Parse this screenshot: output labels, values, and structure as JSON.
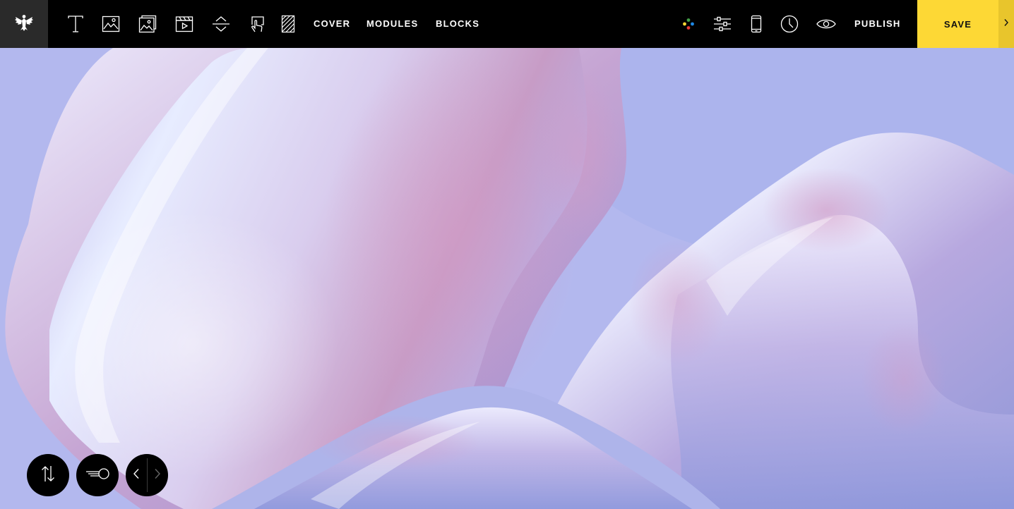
{
  "toolbar": {
    "logo_icon": "eagle-logo-icon",
    "tools": [
      {
        "name": "text-tool",
        "icon": "text-t-icon"
      },
      {
        "name": "image-tool",
        "icon": "image-icon"
      },
      {
        "name": "gallery-tool",
        "icon": "image-stack-icon"
      },
      {
        "name": "video-tool",
        "icon": "video-clapper-icon"
      },
      {
        "name": "spacer-tool",
        "icon": "spacer-arrows-icon"
      },
      {
        "name": "button-tool",
        "icon": "hand-pointer-icon"
      },
      {
        "name": "pattern-tool",
        "icon": "hatch-pattern-icon"
      }
    ],
    "nav": {
      "cover": "COVER",
      "modules": "MODULES",
      "blocks": "BLOCKS"
    },
    "right_tools": [
      {
        "name": "colors-tool",
        "icon": "color-dots-icon"
      },
      {
        "name": "settings-tool",
        "icon": "sliders-icon"
      },
      {
        "name": "mobile-preview-tool",
        "icon": "phone-icon"
      },
      {
        "name": "history-tool",
        "icon": "clock-icon"
      },
      {
        "name": "preview-tool",
        "icon": "eye-icon"
      }
    ],
    "publish_label": "PUBLISH",
    "save_label": "SAVE",
    "colors": {
      "save_bg": "#fdd835",
      "bar_bg": "#000000",
      "dot_red": "#e53935",
      "dot_green": "#43a047",
      "dot_blue": "#1e88e5",
      "dot_yellow": "#fdd835"
    }
  },
  "controls": {
    "reorder_icon": "up-down-arrows-icon",
    "layout_icon": "lines-circle-icon",
    "prev_icon": "chevron-left-icon",
    "next_icon": "chevron-right-icon"
  }
}
